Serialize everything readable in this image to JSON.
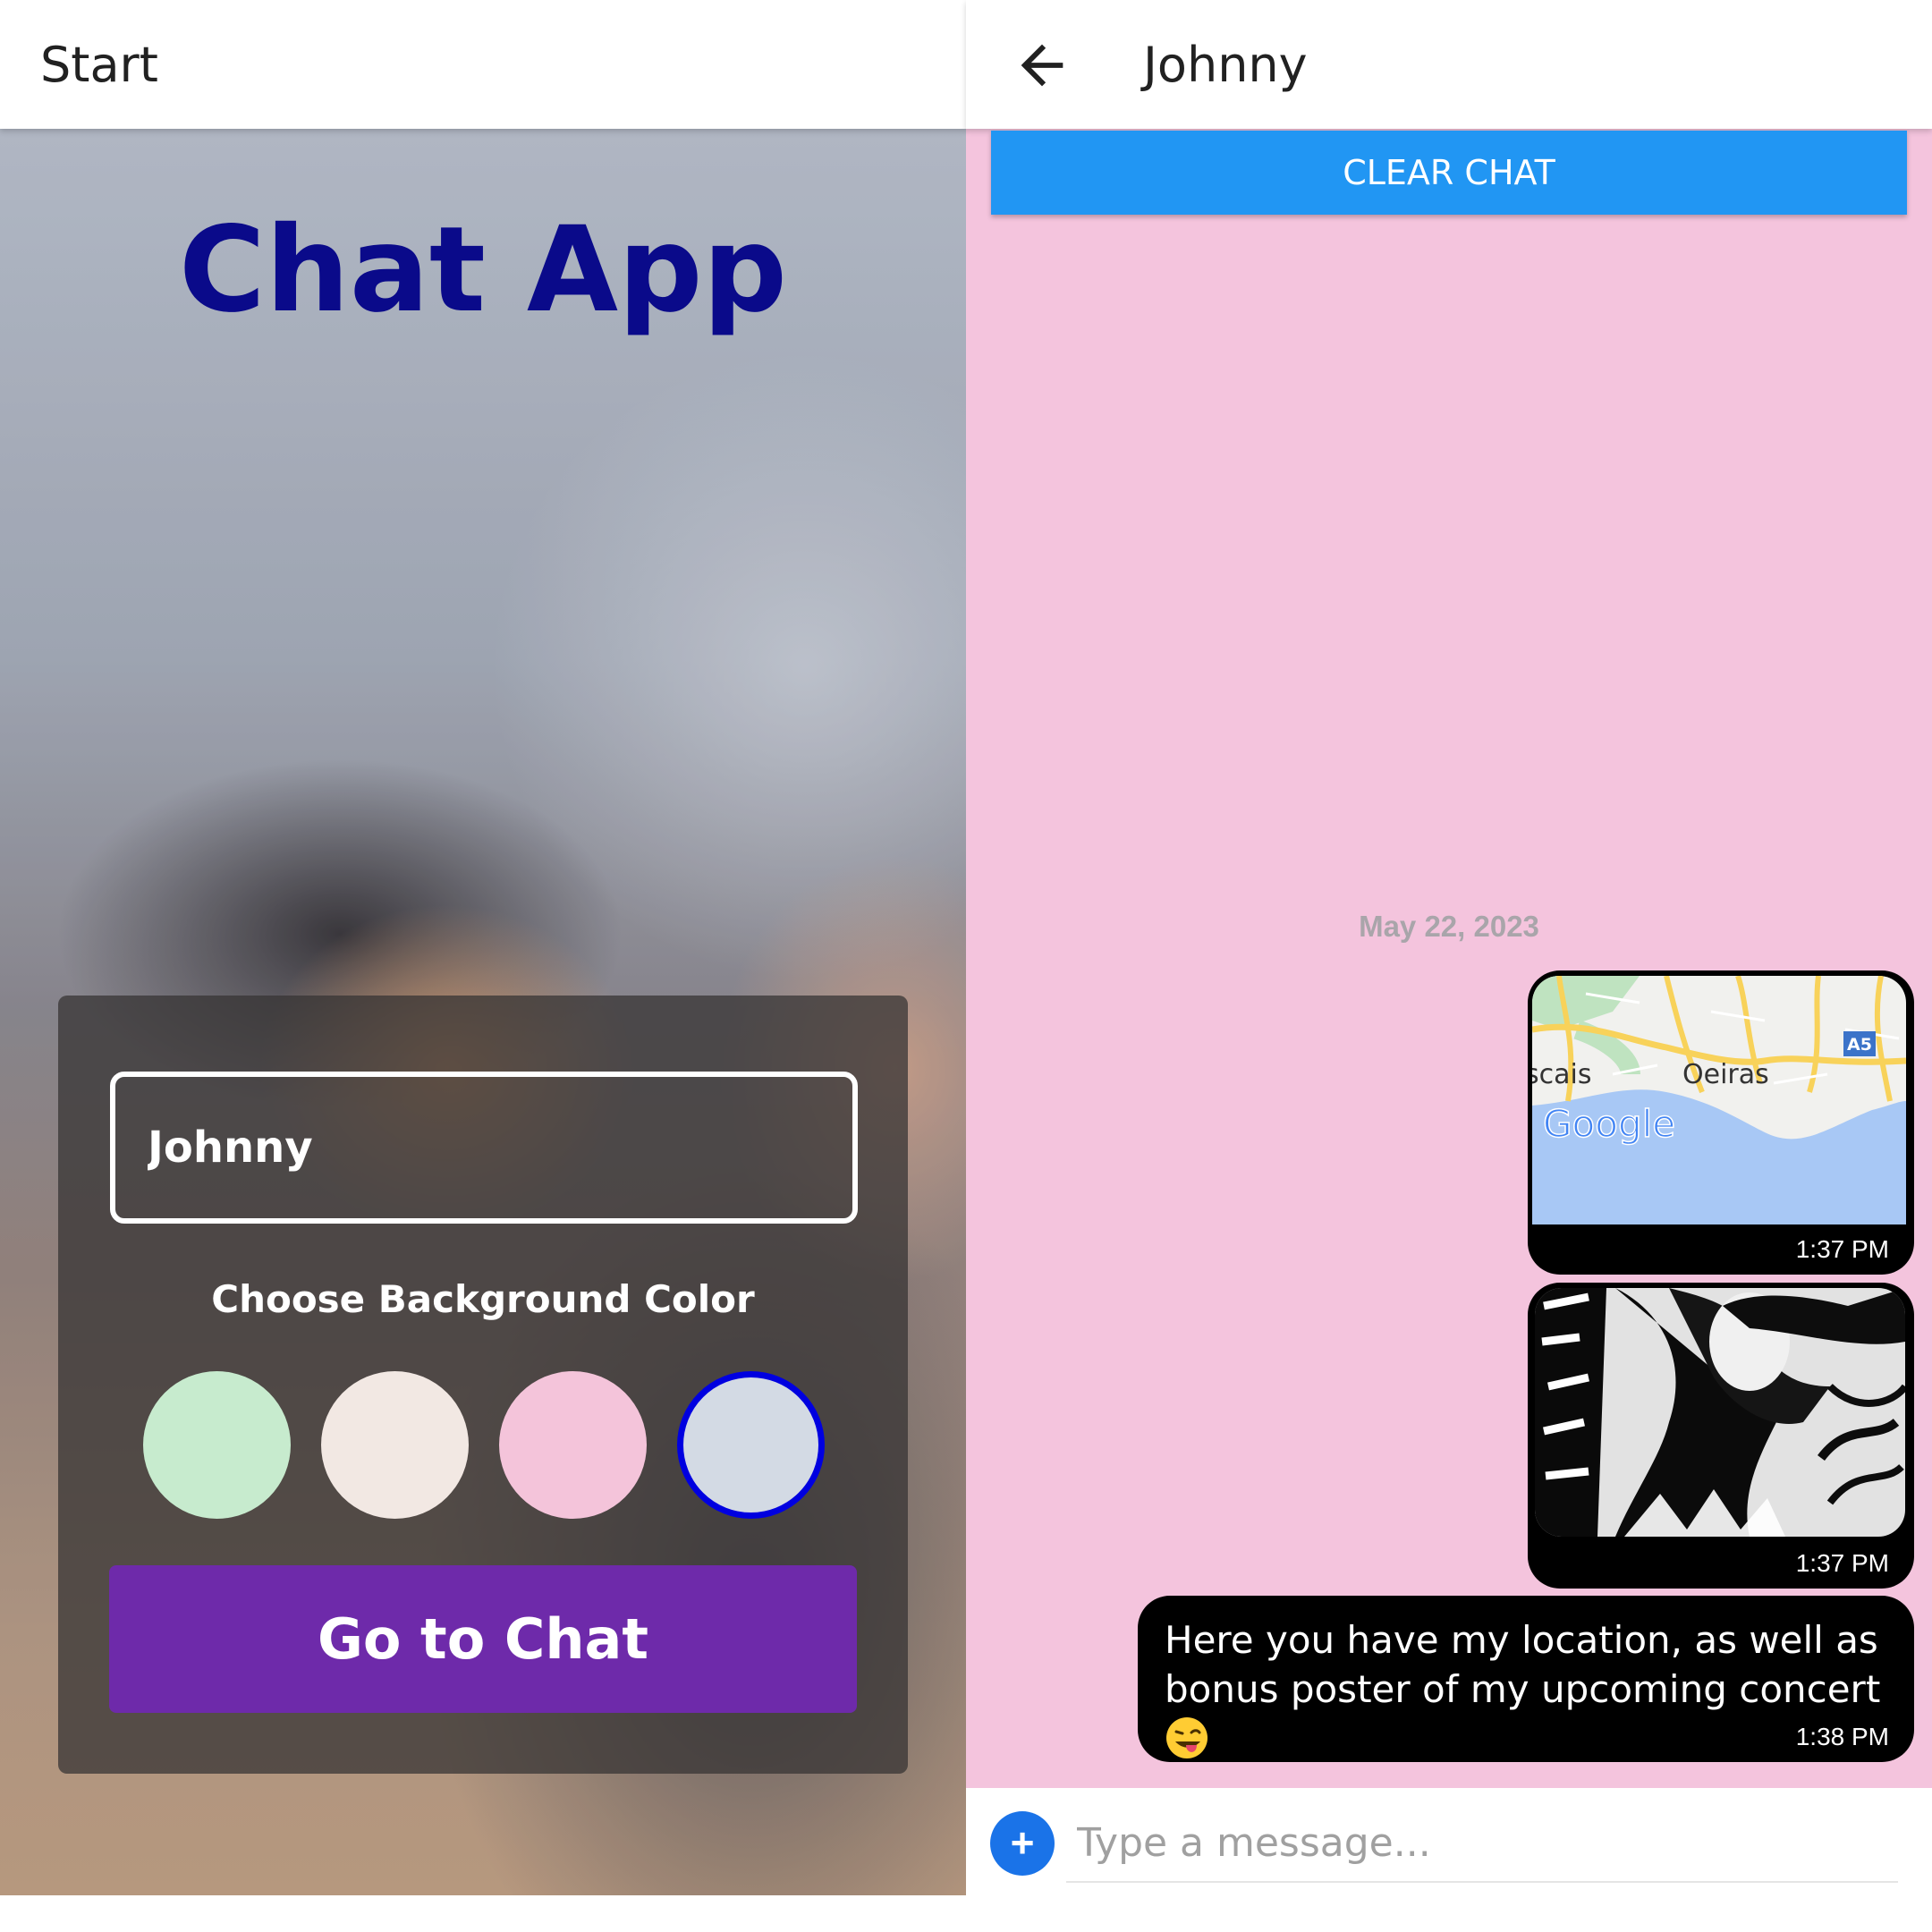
{
  "start_screen": {
    "appbar_title": "Start",
    "app_title": "Chat App",
    "name_input_value": "Johnny",
    "choose_color_label": "Choose Background Color",
    "color_options": [
      {
        "name": "green",
        "color": "#c7ebce",
        "selected": false
      },
      {
        "name": "beige",
        "color": "#f2e8e3",
        "selected": false
      },
      {
        "name": "pink",
        "color": "#f4c4da",
        "selected": false
      },
      {
        "name": "light-blue",
        "color": "#d3dae4",
        "selected": true
      }
    ],
    "go_button_label": "Go to Chat"
  },
  "chat_screen": {
    "back_icon": "arrow-left-icon",
    "appbar_title": "Johnny",
    "background_color": "#f4c4dd",
    "clear_button_label": "CLEAR CHAT",
    "date_separator": "May 22, 2023",
    "messages": [
      {
        "type": "location",
        "map_labels": {
          "town_1": "scais",
          "town_2": "Oeiras",
          "road": "A5",
          "logo": "Google"
        },
        "time": "1:37 PM"
      },
      {
        "type": "image",
        "time": "1:37 PM"
      },
      {
        "type": "text",
        "text": "Here you have my location, as well as bonus poster of my upcoming concert",
        "emoji": "winking-face-with-tongue",
        "time": "1:38 PM"
      }
    ],
    "composer": {
      "placeholder": "Type a message...",
      "action_icon": "plus-icon",
      "action_label": "+"
    }
  },
  "colors": {
    "title_blue": "#0a0a8a",
    "go_button_purple": "#6e2aaa",
    "clear_button_blue": "#2196f3",
    "bubble_black": "#000000",
    "plus_blue": "#1a73e8",
    "selected_ring": "#0000e0"
  }
}
